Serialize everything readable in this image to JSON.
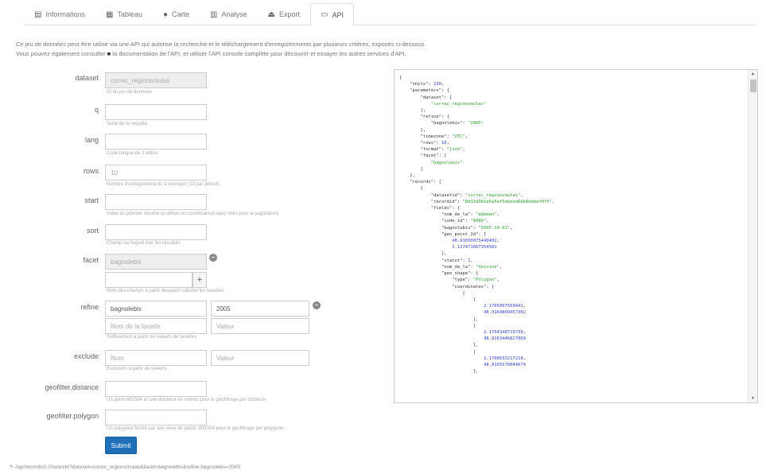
{
  "tabs": [
    {
      "icon": "▤",
      "label": "Informations"
    },
    {
      "icon": "▦",
      "label": "Tableau"
    },
    {
      "icon": "●",
      "label": "Carte"
    },
    {
      "icon": "▥",
      "label": "Analyse"
    },
    {
      "icon": "⏏",
      "label": "Export"
    },
    {
      "icon": "▭",
      "label": "API"
    }
  ],
  "intro": {
    "line1": "Ce jeu de données peut être utilisé via une API qui autorise la recherche et le téléchargement d'enregistrements par plusieurs critères, exposés ci-dessous.",
    "line2a": "Vous pouvez également consulter",
    "line2b": "la documentation de l'API, et utiliser l'API console complète pour découvrir et essayer les autres services d'API."
  },
  "form": {
    "dataset": {
      "label": "dataset",
      "value": "correc_regionsmulas",
      "help": "ID du jeu de données"
    },
    "q": {
      "label": "q",
      "value": "",
      "help": "Texte de la requête"
    },
    "lang": {
      "label": "lang",
      "value": "",
      "help": "Code langue de 2 lettres"
    },
    "rows": {
      "label": "rows",
      "value": "10",
      "help": "Nombre d'enregistrements à renvoyer (10 par défaut)"
    },
    "start": {
      "label": "start",
      "value": "",
      "help": "Index du premier résultat (à utiliser en combinaison avec rows pour la pagination)"
    },
    "sort": {
      "label": "sort",
      "value": "",
      "help": "Champ sur lequel trier les résultats"
    },
    "facet": {
      "label": "facet",
      "value": "bagnolebis",
      "help2": "Nom des champs à partir desquels calculer les facettes"
    },
    "refine": {
      "label": "refine",
      "value": "bagnolebis",
      "value2": "2005",
      "ph1": "Nom de la facette",
      "ph2": "Valeur",
      "help": "Raffinement à partir de valeurs de facettes"
    },
    "exclude": {
      "label": "exclude",
      "ph1": "Nom",
      "ph2": "Valeur",
      "help": "Exclusion à partir de valeurs"
    },
    "geofilter_distance": {
      "label": "geofilter.distance",
      "help": "Un point WGS84 et une distance en mètres pour le géofiltrage par distance"
    },
    "geofilter_polygon": {
      "label": "geofilter.polygon",
      "help": "Un polygone formé par une série de points WGS84 pour le géofiltrage par polygone"
    },
    "submit": "Submit"
  },
  "json_lines": [
    "{",
    "    \"nhits\": 230,",
    "    \"parameters\": {",
    "        \"dataset\": [",
    "            \"correc_regionsmulas\"",
    "        ],",
    "        \"refine\": {",
    "            \"bagnolebis\": \"2005\"",
    "        },",
    "        \"timezone\": \"UTC\",",
    "        \"rows\": 10,",
    "        \"format\": \"json\",",
    "        \"facet\": [",
    "            \"bagnolebis\"",
    "        ]",
    "    },",
    "    \"records\": [",
    "        {",
    "            \"datasetid\": \"correc_regionsmulas\",",
    "            \"recordid\": \"8d13a0b5a5a5af5deeea6bb8bebef0f5\",",
    "            \"fields\": {",
    "                \"nom_de_la\": \"ademen\",",
    "                \"code_id\": \"8480\",",
    "                \"bagnolebis\": \"2005-10-01\",",
    "                \"geo_point_2d\": [",
    "                    48.91650075449402,",
    "                    2.127471667354581",
    "                ],",
    "                \"statut\": 1,",
    "                \"nom_de_la\": \"Voisine\",",
    "                \"geo_shape\": {",
    "                    \"type\": \"Polygon\",",
    "                    \"coordinates\": [",
    "                        [",
    "                            [",
    "                                2.1705097569441,",
    "                                48.9164899457362",
    "                            ],",
    "                            [",
    "                                2.1704348719739,",
    "                                48.9163446827869",
    "                            ],",
    "                            [",
    "                                2.1700633217218,",
    "                                48.9165570044679",
    "                            ],"
  ],
  "url": "/api/records/1.0/search/?dataset=correc_regionsmulas&facet=bagnolebis&refine.bagnolebis=2005"
}
